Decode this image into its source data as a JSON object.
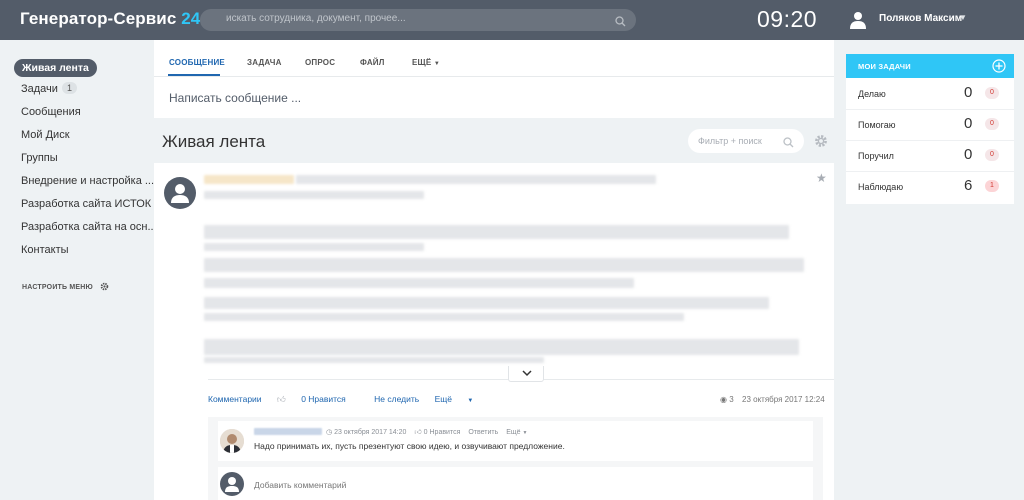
{
  "header": {
    "logo_text": "Генератор-Сервис",
    "logo_num": "24",
    "search_placeholder": "искать сотрудника, документ, прочее...",
    "time": "09:20",
    "user_name": "Поляков Максим"
  },
  "sidebar": {
    "items": [
      {
        "label": "Живая лента"
      },
      {
        "label": "Задачи",
        "count": "1"
      },
      {
        "label": "Сообщения"
      },
      {
        "label": "Мой Диск"
      },
      {
        "label": "Группы"
      },
      {
        "label": "Внедрение и настройка ..."
      },
      {
        "label": "Разработка сайта ИСТОК"
      },
      {
        "label": "Разработка сайта на осн..."
      },
      {
        "label": "Контакты"
      }
    ],
    "configure": "НАСТРОИТЬ МЕНЮ"
  },
  "postform": {
    "tabs": [
      "СООБЩЕНИЕ",
      "ЗАДАЧА",
      "ОПРОС",
      "ФАЙЛ",
      "ЕЩЁ"
    ],
    "placeholder": "Написать сообщение ..."
  },
  "feed": {
    "title": "Живая лента",
    "filter_placeholder": "Фильтр + поиск"
  },
  "post": {
    "actions": {
      "comments": "Комментарии",
      "likes": "0 Нравится",
      "unfollow": "Не следить",
      "more": "Ещё"
    },
    "views": "3",
    "date": "23 октября 2017 12:24",
    "comment": {
      "date": "23 октября 2017 14:20",
      "likes": "0 Нравится",
      "reply": "Ответить",
      "more": "Ещё",
      "text": "Надо принимать их, пусть презентуют свою идею, и озвучивают предложение."
    },
    "add_comment": "Добавить комментарий"
  },
  "tasks": {
    "title": "МОИ ЗАДАЧИ",
    "rows": [
      {
        "label": "Делаю",
        "count": "0",
        "badge": "0"
      },
      {
        "label": "Помогаю",
        "count": "0",
        "badge": "0"
      },
      {
        "label": "Поручил",
        "count": "0",
        "badge": "0"
      },
      {
        "label": "Наблюдаю",
        "count": "6",
        "badge": "1"
      }
    ]
  },
  "colors": {
    "header_bg": "#535c69",
    "accent_blue": "#2fc6f6",
    "link_blue": "#2067b0",
    "page_bg": "#eef2f4",
    "badge_red": "#d0362f"
  }
}
